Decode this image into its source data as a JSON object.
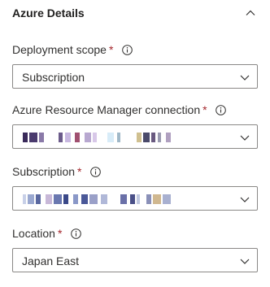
{
  "section": {
    "title": "Azure Details",
    "collapse_icon": "chevron-up-icon"
  },
  "required_marker": "*",
  "fields": {
    "deployment_scope": {
      "label": "Deployment scope",
      "value": "Subscription"
    },
    "arm_connection": {
      "label": "Azure Resource Manager connection",
      "value": ""
    },
    "subscription": {
      "label": "Subscription",
      "value": ""
    },
    "location": {
      "label": "Location",
      "value": "Japan East"
    }
  },
  "colors": {
    "border": "#8a8886",
    "required": "#a4262c",
    "text": "#323130"
  },
  "icons": {
    "info": "info-icon",
    "dropdown": "chevron-down-icon"
  }
}
